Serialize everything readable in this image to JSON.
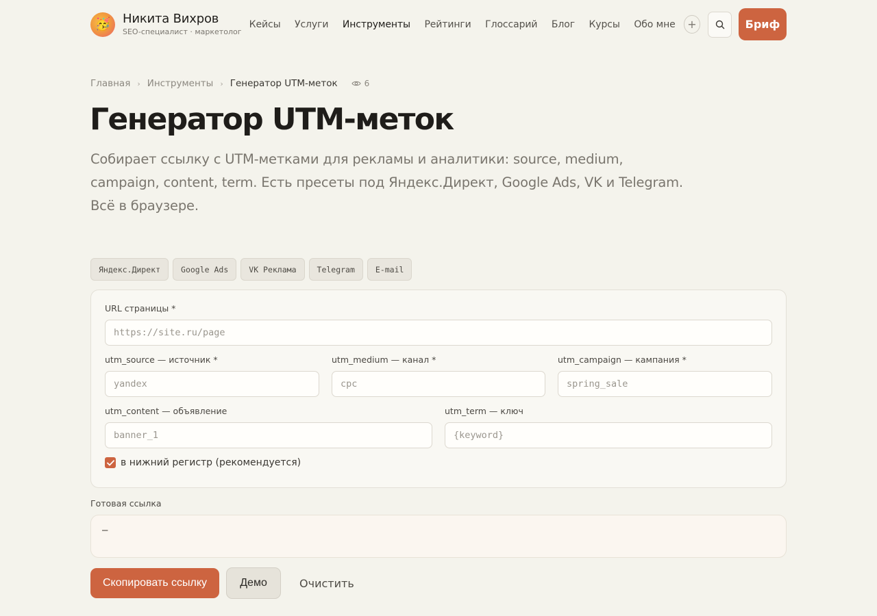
{
  "header": {
    "brand_name": "Никита Вихров",
    "brand_sub": "SEO-специалист · маркетолог",
    "avatar_icon": "🥳",
    "nav": [
      {
        "label": "Кейсы",
        "active": false
      },
      {
        "label": "Услуги",
        "active": false
      },
      {
        "label": "Инструменты",
        "active": true
      },
      {
        "label": "Рейтинги",
        "active": false
      },
      {
        "label": "Глоссарий",
        "active": false
      },
      {
        "label": "Блог",
        "active": false
      },
      {
        "label": "Курсы",
        "active": false
      },
      {
        "label": "Обо мне",
        "active": false
      }
    ],
    "plus_icon": "+",
    "brief_label": "Бриф"
  },
  "breadcrumb": {
    "items": [
      "Главная",
      "Инструменты",
      "Генератор UTM-меток"
    ],
    "separator": "›",
    "views": "6"
  },
  "page": {
    "title": "Генератор UTM-меток",
    "lead": "Собирает ссылку с UTM-метками для рекламы и аналитики: source, medium, campaign, content, term. Есть пресеты под Яндекс.Директ, Google Ads, VK и Telegram. Всё в браузере."
  },
  "presets": [
    "Яндекс.Директ",
    "Google Ads",
    "VK Реклама",
    "Telegram",
    "E-mail"
  ],
  "form": {
    "url": {
      "label": "URL страницы *",
      "placeholder": "https://site.ru/page",
      "value": ""
    },
    "source": {
      "label": "utm_source — источник *",
      "placeholder": "yandex",
      "value": ""
    },
    "medium": {
      "label": "utm_medium — канал *",
      "placeholder": "cpc",
      "value": ""
    },
    "campaign": {
      "label": "utm_campaign — кампания *",
      "placeholder": "spring_sale",
      "value": ""
    },
    "content": {
      "label": "utm_content — объявление",
      "placeholder": "banner_1",
      "value": ""
    },
    "term": {
      "label": "utm_term — ключ",
      "placeholder": "{keyword}",
      "value": ""
    },
    "lowercase": {
      "label": "в нижний регистр (рекомендуется)",
      "checked": true
    }
  },
  "result": {
    "label": "Готовая ссылка",
    "value": "—"
  },
  "actions": {
    "copy": "Скопировать ссылку",
    "demo": "Демо",
    "clear": "Очистить"
  },
  "colors": {
    "accent": "#cd6440",
    "background": "#f4f3ec"
  }
}
